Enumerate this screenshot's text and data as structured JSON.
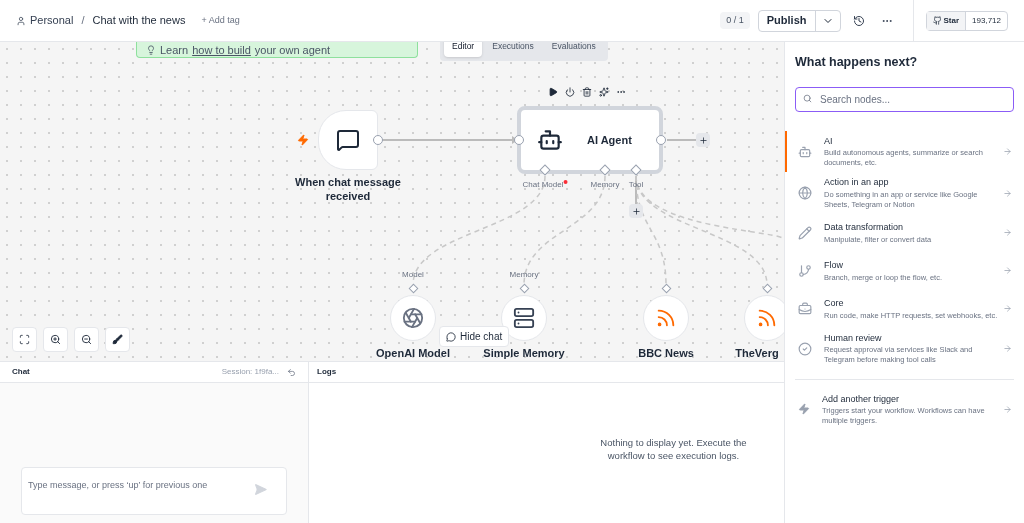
{
  "header": {
    "workspace": "Personal",
    "separator": "/",
    "workflow": "Chat with the news",
    "add_tag": "+ Add tag",
    "counter": "0 / 1",
    "publish": "Publish",
    "github": {
      "label": "Star",
      "count": "193,712"
    }
  },
  "canvas": {
    "note": {
      "before": "Learn",
      "link": "how to build",
      "after": "your own agent"
    },
    "view_tabs": [
      {
        "label": "Editor",
        "selected": true
      },
      {
        "label": "Executions",
        "selected": false
      },
      {
        "label": "Evaluations",
        "selected": false
      }
    ],
    "trigger": {
      "name": "When chat message received"
    },
    "agent": {
      "name": "AI Agent",
      "ports": [
        {
          "label": "Chat Model",
          "required": true
        },
        {
          "label": "Memory",
          "required": false
        },
        {
          "label": "Tool",
          "required": false
        }
      ]
    },
    "sub_nodes": [
      {
        "kind": "model",
        "name": "OpenAI Model",
        "port_label": "Model"
      },
      {
        "kind": "memory",
        "name": "Simple Memory",
        "port_label": "Memory"
      },
      {
        "kind": "rss",
        "name": "BBC News"
      },
      {
        "kind": "rss",
        "name": "TheVerg"
      }
    ],
    "hide_chat": "Hide chat"
  },
  "chat": {
    "title": "Chat",
    "session": "Session: 1f9fa...",
    "placeholder": "Type message, or press ‘up’ for previous one"
  },
  "logs": {
    "title": "Logs",
    "empty": "Nothing to display yet. Execute the workflow to see execution logs."
  },
  "panel": {
    "title": "What happens next?",
    "search_placeholder": "Search nodes...",
    "items": [
      {
        "kind": "ai",
        "title": "AI",
        "description": "Build autonomous agents, summarize or search documents, etc.",
        "selected": true
      },
      {
        "kind": "app",
        "title": "Action in an app",
        "description": "Do something in an app or service like Google Sheets, Telegram or Notion",
        "selected": false
      },
      {
        "kind": "transform",
        "title": "Data transformation",
        "description": "Manipulate, filter or convert data",
        "selected": false
      },
      {
        "kind": "flow",
        "title": "Flow",
        "description": "Branch, merge or loop the flow, etc.",
        "selected": false
      },
      {
        "kind": "core",
        "title": "Core",
        "description": "Run code, make HTTP requests, set webhooks, etc.",
        "selected": false
      },
      {
        "kind": "review",
        "title": "Human review",
        "description": "Request approval via services like Slack and Telegram before making tool calls",
        "selected": false
      }
    ],
    "trigger": {
      "title": "Add another trigger",
      "description": "Triggers start your workflow. Workflows can have multiple triggers."
    }
  }
}
